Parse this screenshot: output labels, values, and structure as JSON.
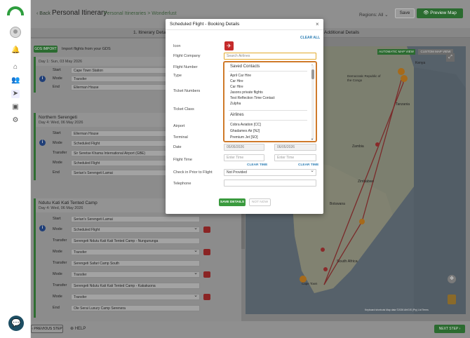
{
  "header": {
    "back_label": "Back",
    "title": "Personal Itinerary",
    "breadcrumb": "Personal Itineraries > Wonderlust",
    "regions": "Regions: All",
    "save_label": "Save",
    "preview_label": "Preview Map"
  },
  "tabs": [
    "1. Itinerary Details",
    "Additional Details"
  ],
  "gds": {
    "button": "GDS IMPORT",
    "text": "Import flights from your GDS"
  },
  "days": [
    {
      "name": "",
      "date": "Day 1: Sun, 03 May 2026",
      "rows": [
        {
          "label": "Start",
          "value": "Cape Town Station"
        },
        {
          "label": "Mode",
          "value": "Transfer"
        },
        {
          "label": "End",
          "value": "Ellerman House"
        }
      ]
    },
    {
      "name": "Northern Serengeti",
      "date": "Day 4: Wed, 06 May 2026",
      "rows": [
        {
          "label": "Start",
          "value": "Ellerman House"
        },
        {
          "label": "Mode",
          "value": "Scheduled Flight"
        },
        {
          "label": "Transfer",
          "value": "Sir Seretse Khama International Airport (GBE)"
        },
        {
          "label": "Mode",
          "value": "Scheduled Flight"
        },
        {
          "label": "End",
          "value": "Serian's Serengeti Lamai"
        }
      ]
    },
    {
      "name": "Ndutu Kati Kati Tented Camp",
      "date": "Day 4: Wed, 06 May 2026",
      "rows": [
        {
          "label": "Start",
          "value": "Serian's Serengeti Lamai"
        },
        {
          "label": "Mode",
          "value": "Scheduled Flight"
        },
        {
          "label": "Transfer",
          "value": "Serengeti Ndutu Kati Kati Tented Camp - Nungununga"
        },
        {
          "label": "Mode",
          "value": "Transfer"
        },
        {
          "label": "Transfer",
          "value": "Serengeti Safari Camp South"
        },
        {
          "label": "Mode",
          "value": "Transfer"
        },
        {
          "label": "Transfer",
          "value": "Serengeti Ndutu Kati Kati Tented Camp - Kakakuona"
        },
        {
          "label": "Mode",
          "value": "Transfer"
        },
        {
          "label": "End",
          "value": "Ole Serai Luxury Camp Serenera"
        }
      ]
    }
  ],
  "map": {
    "toggle1": "AUTOMATIC MAP VIEW",
    "toggle2": "CUSTOM MAP VIEW",
    "attribution": "Keyboard shortcuts  Map data ©2026 AfriGIS (Pty) Ltd  Terms",
    "labels": [
      "Kenya",
      "Democratic Republic of the Congo",
      "Tanzania",
      "Zambia",
      "Zimbabwe",
      "Botswana",
      "South Africa",
      "Cape Town"
    ]
  },
  "footer": {
    "prev": "PREVIOUS STEP",
    "help": "HELP",
    "next": "NEXT STEP"
  },
  "modal": {
    "title": "Scheduled Flight - Booking Details",
    "clear_all": "CLEAR ALL",
    "labels": {
      "icon": "Icon",
      "company": "Flight Company",
      "number": "Flight Number",
      "type": "Type",
      "ticket_numbers": "Ticket Numbers",
      "ticket_class": "Ticket Class",
      "airport": "Airport",
      "terminal": "Terminal",
      "date": "Date",
      "flight_time": "Flight Time",
      "check_in": "Check in Prior to Flight",
      "telephone": "Telephone"
    },
    "search_placeholder": "Search Airlines",
    "date_from": "05/05/2026",
    "date_to": "06/05/2026",
    "time_placeholder": "Enter Time",
    "clear_time": "CLEAR TIME",
    "check_in_value": "Not Provided",
    "save": "SAVE DETAILS",
    "not_now": "NOT NOW"
  },
  "dropdown": {
    "group1": "Saved Contacts",
    "contacts": [
      "April Car Hire",
      "Car Hire",
      "Car Hire",
      "Jasons private flights",
      "Test Reflection Time Contact",
      "Zulpha"
    ],
    "group2": "Airlines",
    "airlines": [
      "Cobra Aviation [CC]",
      "Ghadames Air [NJ]",
      "Premium Jet [SO]"
    ]
  },
  "colors": {
    "brand_green": "#2e9e3e",
    "flight_red": "#c52a2a",
    "highlight_orange": "#cf7a2a"
  }
}
